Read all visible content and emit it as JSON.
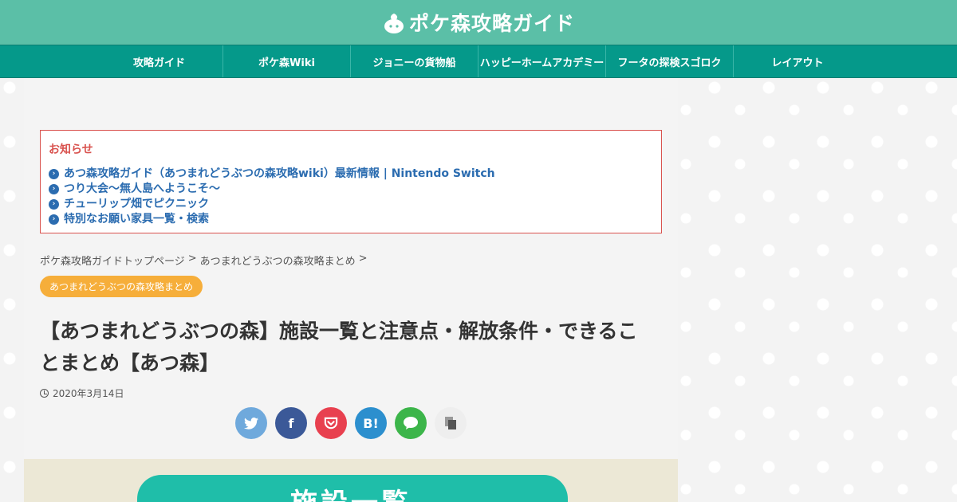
{
  "site": {
    "logo_text": "ポケ森攻略ガイド"
  },
  "nav": {
    "items": [
      {
        "label": "攻略ガイド"
      },
      {
        "label": "ポケ森Wiki"
      },
      {
        "label": "ジョニーの貨物船"
      },
      {
        "label": "ハッピーホームアカデミー"
      },
      {
        "label": "フータの探検スゴロク"
      },
      {
        "label": "レイアウト"
      }
    ]
  },
  "notice": {
    "title": "お知らせ",
    "items": [
      {
        "label": "あつ森攻略ガイド（あつまれどうぶつの森攻略wiki）最新情報 | Nintendo Switch"
      },
      {
        "label": "つり大会〜無人島へようこそ〜"
      },
      {
        "label": "チューリップ畑でピクニック"
      },
      {
        "label": "特別なお願い家具一覧・検索"
      }
    ]
  },
  "breadcrumb": {
    "items": [
      {
        "label": "ポケ森攻略ガイドトップページ"
      },
      {
        "label": "あつまれどうぶつの森攻略まとめ"
      }
    ],
    "separator": ">"
  },
  "category": {
    "label": "あつまれどうぶつの森攻略まとめ"
  },
  "article": {
    "title": "【あつまれどうぶつの森】施設一覧と注意点・解放条件・できることまとめ【あつ森】",
    "date": "2020年3月14日"
  },
  "share": {
    "buttons": [
      {
        "name": "twitter",
        "icon": "twitter-bird",
        "color": "#6fa9dc"
      },
      {
        "name": "facebook",
        "label": "f",
        "color": "#3b5998"
      },
      {
        "name": "pocket",
        "icon": "pocket",
        "color": "#e8404f"
      },
      {
        "name": "hatena",
        "label": "B!",
        "color": "#2c8fce"
      },
      {
        "name": "line",
        "icon": "speech-bubble",
        "color": "#3cb54a"
      },
      {
        "name": "copy",
        "icon": "copy",
        "color": "#eeeeee"
      }
    ]
  },
  "hero": {
    "text": "施設一覧"
  },
  "colors": {
    "header": "#5bbfa7",
    "nav": "#05998a",
    "notice_border": "#d9534f",
    "link": "#2b6cb0",
    "badge": "#f6ae3a"
  }
}
